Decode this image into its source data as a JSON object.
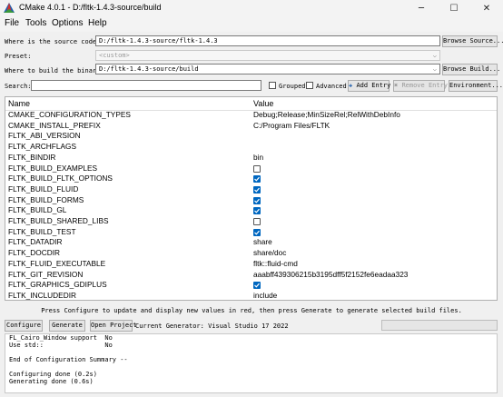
{
  "window": {
    "title": "CMake 4.0.1 - D:/fltk-1.4.3-source/build"
  },
  "menu": {
    "file": "File",
    "tools": "Tools",
    "options": "Options",
    "help": "Help"
  },
  "source": {
    "label": "Where is the source code:",
    "value": "D:/fltk-1.4.3-source/fltk-1.4.3",
    "button": "Browse Source..."
  },
  "preset": {
    "label": "Preset:",
    "value": "<custom>"
  },
  "build": {
    "label": "Where to build the binaries:",
    "value": "D:/fltk-1.4.3-source/build",
    "button": "Browse Build..."
  },
  "toolbar": {
    "search_label": "Search:",
    "grouped": "Grouped",
    "advanced": "Advanced",
    "add_entry": "Add Entry",
    "remove_entry": "Remove Entry",
    "environment": "Environment..."
  },
  "table": {
    "col_name": "Name",
    "col_value": "Value",
    "rows": [
      {
        "name": "CMAKE_CONFIGURATION_TYPES",
        "value": "Debug;Release;MinSizeRel;RelWithDebInfo"
      },
      {
        "name": "CMAKE_INSTALL_PREFIX",
        "value": "C:/Program Files/FLTK"
      },
      {
        "name": "FLTK_ABI_VERSION",
        "value": ""
      },
      {
        "name": "FLTK_ARCHFLAGS",
        "value": ""
      },
      {
        "name": "FLTK_BINDIR",
        "value": "bin"
      },
      {
        "name": "FLTK_BUILD_EXAMPLES",
        "bool": false
      },
      {
        "name": "FLTK_BUILD_FLTK_OPTIONS",
        "bool": true
      },
      {
        "name": "FLTK_BUILD_FLUID",
        "bool": true
      },
      {
        "name": "FLTK_BUILD_FORMS",
        "bool": true
      },
      {
        "name": "FLTK_BUILD_GL",
        "bool": true
      },
      {
        "name": "FLTK_BUILD_SHARED_LIBS",
        "bool": false
      },
      {
        "name": "FLTK_BUILD_TEST",
        "bool": true
      },
      {
        "name": "FLTK_DATADIR",
        "value": "share"
      },
      {
        "name": "FLTK_DOCDIR",
        "value": "share/doc"
      },
      {
        "name": "FLTK_FLUID_EXECUTABLE",
        "value": "fltk::fluid-cmd"
      },
      {
        "name": "FLTK_GIT_REVISION",
        "value": "aaabff439306215b3195dff5f2152fe6eadaa323"
      },
      {
        "name": "FLTK_GRAPHICS_GDIPLUS",
        "bool": true
      },
      {
        "name": "FLTK_INCLUDEDIR",
        "value": "include"
      }
    ]
  },
  "status": {
    "text": "Press Configure to update and display new values in red, then press Generate to generate selected build files."
  },
  "actions": {
    "configure": "Configure",
    "generate": "Generate",
    "open_project": "Open Project",
    "generator": "Current Generator: Visual Studio 17 2022"
  },
  "output": {
    "lines": [
      "FL_Cairo_Window support  No",
      "Use std::                No",
      "",
      "End of Configuration Summary --",
      "",
      "Configuring done (0.2s)",
      "Generating done (0.6s)"
    ]
  },
  "icons": {
    "app": "cmake-triangle-icon",
    "add": "plus-icon",
    "remove": "cross-icon"
  },
  "colors": {
    "checkbox_on": "#0067c0",
    "app_icon_red": "#d0312d",
    "app_icon_blue": "#1f5fae"
  }
}
